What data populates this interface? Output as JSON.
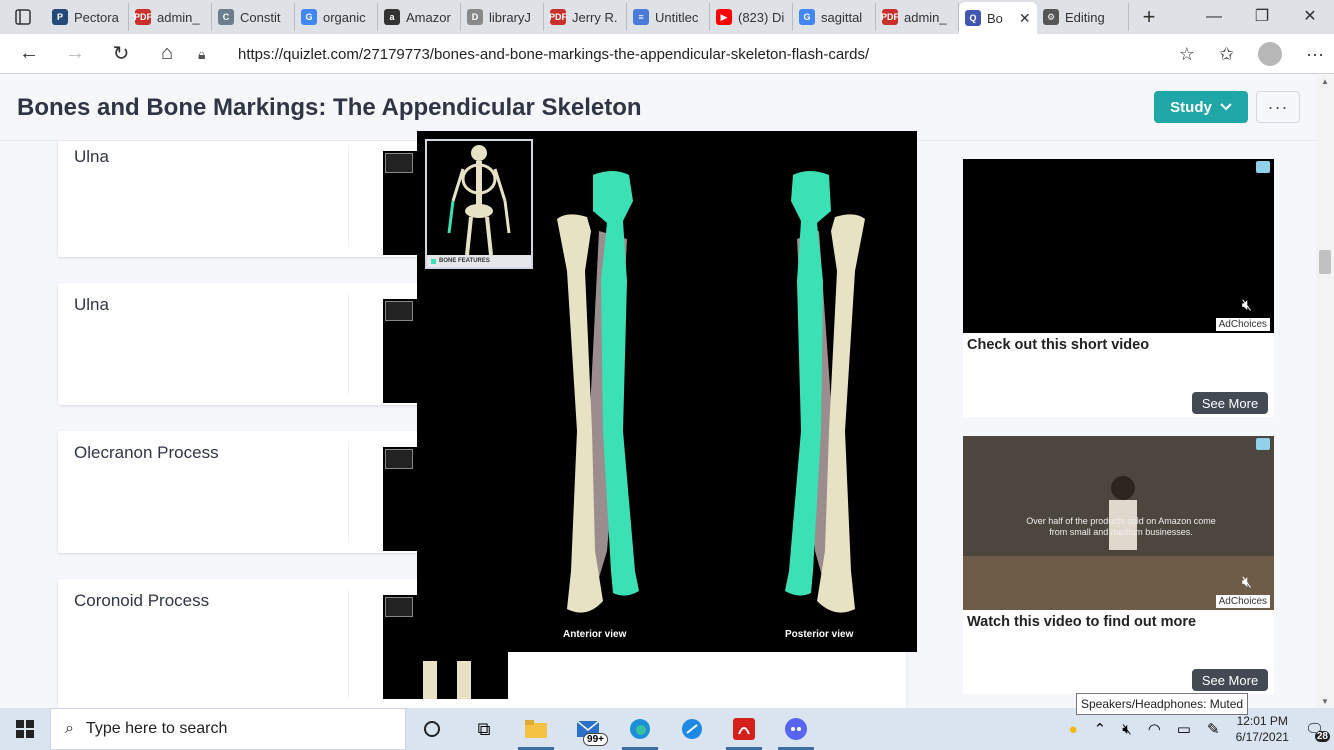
{
  "browser": {
    "tabs": [
      {
        "label": "Pectora",
        "icon": "P",
        "color": "#234a7a"
      },
      {
        "label": "admin_",
        "icon": "PDF",
        "color": "#c9302c"
      },
      {
        "label": "Constit",
        "icon": "C",
        "color": "#6b7d8f"
      },
      {
        "label": "organic",
        "icon": "G",
        "color": "#4285f4"
      },
      {
        "label": "Amazor",
        "icon": "a",
        "color": "#333333"
      },
      {
        "label": "libraryJ",
        "icon": "D",
        "color": "#888888"
      },
      {
        "label": "Jerry R.",
        "icon": "PDF",
        "color": "#c9302c"
      },
      {
        "label": "Untitlec",
        "icon": "≡",
        "color": "#4a7bd8"
      },
      {
        "label": "(823) Di",
        "icon": "▶",
        "color": "#ff0000"
      },
      {
        "label": "sagittal",
        "icon": "G",
        "color": "#4285f4"
      },
      {
        "label": "admin_",
        "icon": "PDF",
        "color": "#c9302c"
      },
      {
        "label": "Bo",
        "icon": "Q",
        "color": "#4257b2",
        "active": true
      },
      {
        "label": "Editing",
        "icon": "⚙",
        "color": "#555555"
      }
    ],
    "url": "https://quizlet.com/27179773/bones-and-bone-markings-the-appendicular-skeleton-flash-cards/"
  },
  "page": {
    "title": "Bones and Bone Markings: The Appendicular Skeleton",
    "study_label": "Study",
    "more_label": "···",
    "cards": [
      {
        "term": "Ulna"
      },
      {
        "term": "Ulna"
      },
      {
        "term": "Olecranon Process"
      },
      {
        "term": "Coronoid Process"
      }
    ]
  },
  "modal": {
    "inset_label": "BONE FEATURES",
    "anterior_label": "Anterior view",
    "posterior_label": "Posterior view"
  },
  "ads": [
    {
      "title": "Check out this short video",
      "see_more": "See More",
      "adchoices": "AdChoices",
      "overlay": ""
    },
    {
      "title": "Watch this video to find out more",
      "see_more": "See More",
      "adchoices": "AdChoices",
      "overlay": "Over half of the products sold on Amazon come from small and medium businesses."
    }
  ],
  "taskbar": {
    "search_placeholder": "Type here to search",
    "mail_badge": "99+",
    "time": "12:01 PM",
    "date": "6/17/2021",
    "notif_count": "28",
    "tooltip": "Speakers/Headphones: Muted"
  },
  "colors": {
    "accent": "#1fa6a6",
    "ulna": "#3be0b4",
    "radius": "#e8e2c4"
  }
}
